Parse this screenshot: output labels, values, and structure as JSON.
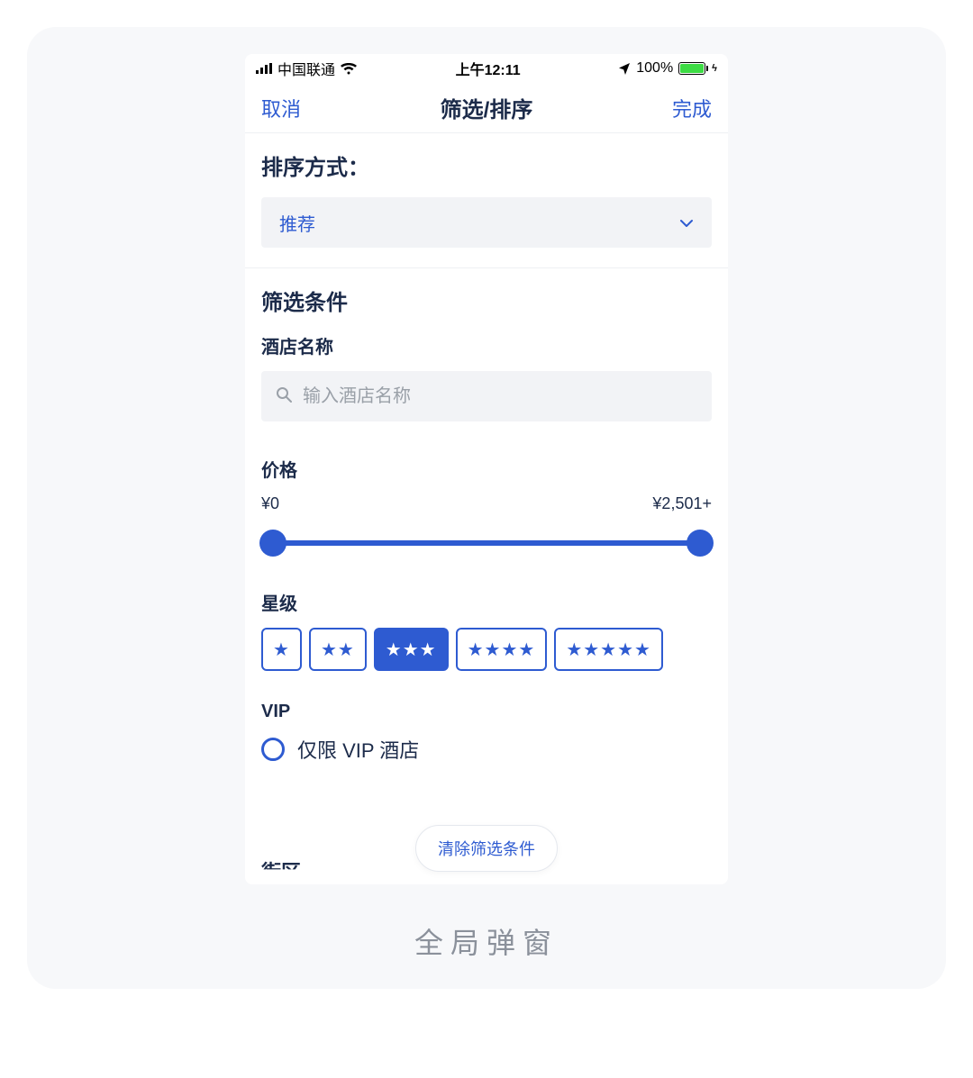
{
  "status": {
    "carrier": "中国联通",
    "time": "上午12:11",
    "battery_pct": "100%"
  },
  "nav": {
    "cancel": "取消",
    "title": "筛选/排序",
    "done": "完成"
  },
  "sort": {
    "heading": "排序方式：",
    "value": "推荐"
  },
  "filter": {
    "heading": "筛选条件",
    "hotel_name_label": "酒店名称",
    "hotel_name_placeholder": "输入酒店名称",
    "price_label": "价格",
    "price_min": "¥0",
    "price_max": "¥2,501+",
    "stars_label": "星级",
    "stars_selected": 3,
    "vip_label": "VIP",
    "vip_option": "仅限 VIP 酒店",
    "truncated_next": "街区"
  },
  "clear_button": "清除筛选条件",
  "caption": "全局弹窗",
  "colors": {
    "accent": "#2e5bd1",
    "text": "#1c2b4a",
    "bg_card": "#f7f8fa",
    "bg_input": "#f2f3f6",
    "battery_green": "#3ddc44"
  }
}
